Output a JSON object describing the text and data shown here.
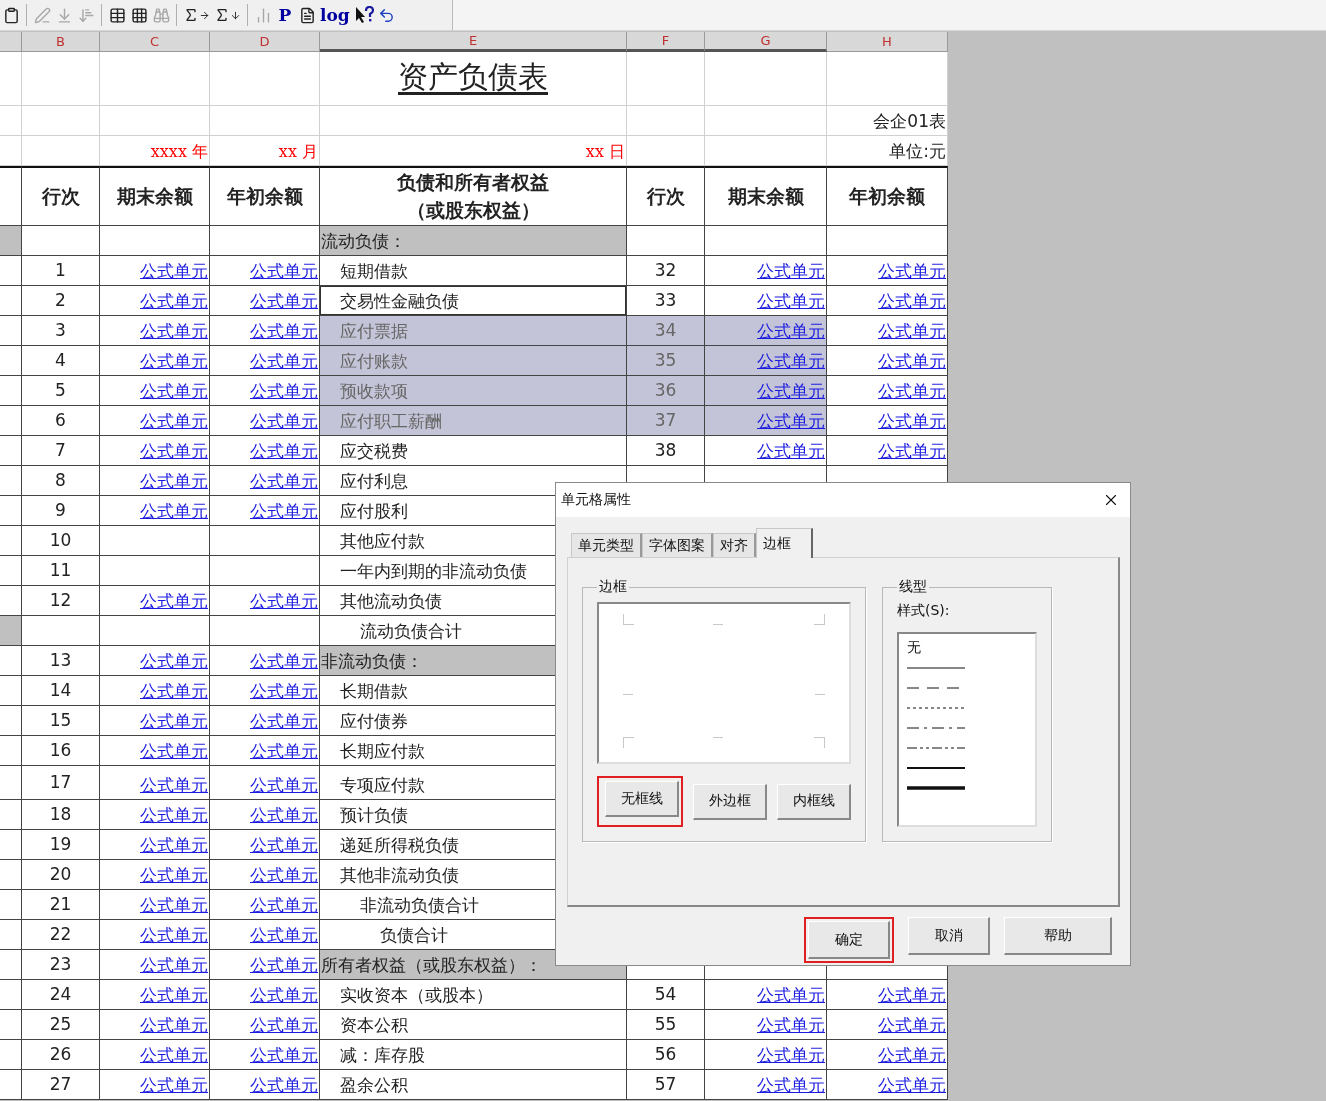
{
  "toolbar": {
    "groups": [
      [
        {
          "kind": "paste",
          "disabled": false
        }
      ],
      [
        {
          "kind": "pen",
          "disabled": true
        },
        {
          "kind": "fill-down",
          "disabled": true
        },
        {
          "kind": "sort",
          "disabled": true
        }
      ],
      [
        {
          "kind": "table",
          "disabled": false
        },
        {
          "kind": "grid",
          "disabled": false
        },
        {
          "kind": "find",
          "disabled": true
        }
      ],
      [
        {
          "kind": "sum-right",
          "disabled": false
        },
        {
          "kind": "sum-down",
          "disabled": false
        }
      ],
      [
        {
          "kind": "chart",
          "disabled": true
        },
        {
          "kind": "text",
          "label": "P",
          "disabled": false
        },
        {
          "kind": "document",
          "disabled": false
        },
        {
          "kind": "text",
          "label": "log",
          "disabled": false
        },
        {
          "kind": "help",
          "disabled": false
        },
        {
          "kind": "undo",
          "disabled": false
        }
      ]
    ]
  },
  "sheet": {
    "columns": [
      {
        "label": "B",
        "selected": false
      },
      {
        "label": "C",
        "selected": false
      },
      {
        "label": "D",
        "selected": false
      },
      {
        "label": "E",
        "selected": true
      },
      {
        "label": "F",
        "selected": true
      },
      {
        "label": "G",
        "selected": true
      },
      {
        "label": "H",
        "selected": false
      }
    ],
    "title": "资产负债表",
    "form_no": "会企01表",
    "year": "xxxx 年",
    "month": "xx 月",
    "day": "xx 日",
    "unit": "单位:元",
    "headers": {
      "line": "行次",
      "end": "期末余额",
      "begin": "年初余额",
      "item_line1": "负债和所有者权益",
      "item_line2": "（或股东权益）",
      "line2": "行次",
      "end2": "期末余额",
      "begin2": "年初余额"
    },
    "rows": [
      {
        "kind": "section",
        "item": "流动负债：",
        "selected": false
      },
      {
        "kind": "item",
        "line": "1",
        "end": "公式单元",
        "begin": "公式单元",
        "item": "短期借款",
        "line2": "32",
        "end2": "公式单元",
        "begin2": "公式单元",
        "selected": false
      },
      {
        "kind": "item",
        "line": "2",
        "end": "公式单元",
        "begin": "公式单元",
        "item": "交易性金融负债",
        "line2": "33",
        "end2": "公式单元",
        "begin2": "公式单元",
        "selected": true
      },
      {
        "kind": "item",
        "line": "3",
        "end": "公式单元",
        "begin": "公式单元",
        "item": "应付票据",
        "line2": "34",
        "end2": "公式单元",
        "begin2": "公式单元",
        "selected": true
      },
      {
        "kind": "item",
        "line": "4",
        "end": "公式单元",
        "begin": "公式单元",
        "item": "应付账款",
        "line2": "35",
        "end2": "公式单元",
        "begin2": "公式单元",
        "selected": true
      },
      {
        "kind": "item",
        "line": "5",
        "end": "公式单元",
        "begin": "公式单元",
        "item": "预收款项",
        "line2": "36",
        "end2": "公式单元",
        "begin2": "公式单元",
        "selected": true
      },
      {
        "kind": "item",
        "line": "6",
        "end": "公式单元",
        "begin": "公式单元",
        "item": "应付职工薪酬",
        "line2": "37",
        "end2": "公式单元",
        "begin2": "公式单元",
        "selected": true
      },
      {
        "kind": "item",
        "line": "7",
        "end": "公式单元",
        "begin": "公式单元",
        "item": "应交税费",
        "line2": "38",
        "end2": "公式单元",
        "begin2": "公式单元",
        "selected": false
      },
      {
        "kind": "item",
        "line": "8",
        "end": "公式单元",
        "begin": "公式单元",
        "item": "应付利息",
        "selected": false
      },
      {
        "kind": "item",
        "line": "9",
        "end": "公式单元",
        "begin": "公式单元",
        "item": "应付股利",
        "selected": false
      },
      {
        "kind": "item",
        "line": "10",
        "item": "其他应付款",
        "selected": false
      },
      {
        "kind": "item",
        "line": "11",
        "item": "一年内到期的非流动负债",
        "selected": false
      },
      {
        "kind": "item",
        "line": "12",
        "end": "公式单元",
        "begin": "公式单元",
        "item": "其他流动负债",
        "selected": false
      },
      {
        "kind": "subtotal",
        "item": "流动负债合计",
        "selected": false
      },
      {
        "kind": "section",
        "line": "13",
        "end": "公式单元",
        "begin": "公式单元",
        "item": "非流动负债：",
        "selected": false
      },
      {
        "kind": "item",
        "line": "14",
        "end": "公式单元",
        "begin": "公式单元",
        "item": "长期借款",
        "selected": false
      },
      {
        "kind": "item",
        "line": "15",
        "end": "公式单元",
        "begin": "公式单元",
        "item": "应付债券",
        "selected": false
      },
      {
        "kind": "item",
        "line": "16",
        "end": "公式单元",
        "begin": "公式单元",
        "item": "长期应付款",
        "selected": false
      },
      {
        "kind": "item",
        "line": "17",
        "end": "公式单元",
        "begin": "公式单元",
        "item": "专项应付款",
        "selected": false
      },
      {
        "kind": "item",
        "line": "18",
        "end": "公式单元",
        "begin": "公式单元",
        "item": "预计负债",
        "selected": false
      },
      {
        "kind": "item",
        "line": "19",
        "end": "公式单元",
        "begin": "公式单元",
        "item": "递延所得税负债",
        "selected": false
      },
      {
        "kind": "item",
        "line": "20",
        "end": "公式单元",
        "begin": "公式单元",
        "item": "其他非流动负债",
        "selected": false
      },
      {
        "kind": "subtotal",
        "line": "21",
        "end": "公式单元",
        "begin": "公式单元",
        "item": "非流动负债合计",
        "selected": false
      },
      {
        "kind": "total",
        "line": "22",
        "end": "公式单元",
        "begin": "公式单元",
        "item": "负债合计",
        "selected": false
      },
      {
        "kind": "section",
        "line": "23",
        "end": "公式单元",
        "begin": "公式单元",
        "item": "所有者权益（或股东权益）：",
        "selected": false
      },
      {
        "kind": "item",
        "line": "24",
        "end": "公式单元",
        "begin": "公式单元",
        "item": "实收资本（或股本）",
        "line2": "54",
        "end2": "公式单元",
        "begin2": "公式单元",
        "selected": false
      },
      {
        "kind": "item",
        "line": "25",
        "end": "公式单元",
        "begin": "公式单元",
        "item": "资本公积",
        "line2": "55",
        "end2": "公式单元",
        "begin2": "公式单元",
        "selected": false
      },
      {
        "kind": "item",
        "line": "26",
        "end": "公式单元",
        "begin": "公式单元",
        "item": "减：库存股",
        "line2": "56",
        "end2": "公式单元",
        "begin2": "公式单元",
        "selected": false
      },
      {
        "kind": "item",
        "line": "27",
        "end": "公式单元",
        "begin": "公式单元",
        "item": "盈余公积",
        "line2": "57",
        "end2": "公式单元",
        "begin2": "公式单元",
        "selected": false
      }
    ]
  },
  "dialog": {
    "title": "单元格属性",
    "tabs": [
      {
        "label": "单元类型",
        "selected": false
      },
      {
        "label": "字体图案",
        "selected": false
      },
      {
        "label": "对齐",
        "selected": false
      },
      {
        "label": "边框",
        "selected": true
      }
    ],
    "border_group": {
      "label": "边框",
      "buttons": [
        {
          "label": "无框线",
          "highlighted": true
        },
        {
          "label": "外边框",
          "highlighted": false
        },
        {
          "label": "内框线",
          "highlighted": false
        }
      ]
    },
    "line_group": {
      "label": "线型",
      "list_label": "样式(S):",
      "styles": [
        {
          "kind": "none",
          "label": "无"
        },
        {
          "kind": "thin"
        },
        {
          "kind": "dashed"
        },
        {
          "kind": "dotted"
        },
        {
          "kind": "dash-dot"
        },
        {
          "kind": "dash-dot-dot"
        },
        {
          "kind": "medium"
        },
        {
          "kind": "thick"
        }
      ]
    },
    "buttons": [
      {
        "label": "确定",
        "highlighted": true
      },
      {
        "label": "取消",
        "highlighted": false
      },
      {
        "label": "帮助",
        "highlighted": false
      }
    ]
  }
}
